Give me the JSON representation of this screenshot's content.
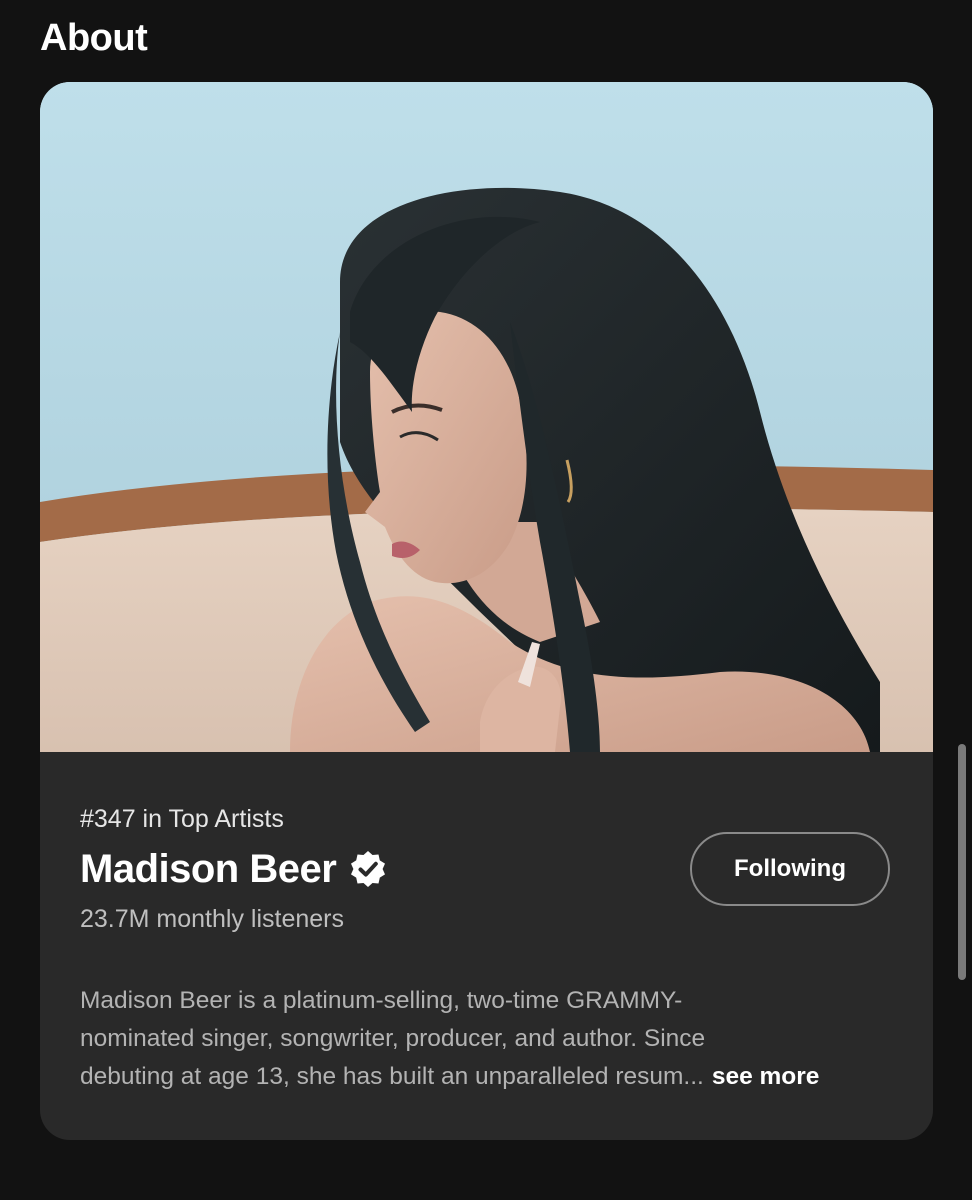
{
  "section": {
    "title": "About"
  },
  "artist": {
    "rank": "#347 in Top Artists",
    "name": "Madison Beer",
    "verified": true,
    "listeners": "23.7M monthly listeners",
    "follow_label": "Following",
    "bio_lines": [
      "Madison Beer is a platinum-selling, two-time GRAMMY-",
      "nominated singer, songwriter, producer, and author. Since",
      "debuting at age 13, she has built an unparalleled resum..."
    ],
    "see_more_label": "see more"
  },
  "icons": {
    "verified": "verified-badge-icon"
  },
  "colors": {
    "background": "#121212",
    "card": "#292929",
    "verified_badge": "#ffffff",
    "verified_check": "#292929"
  }
}
